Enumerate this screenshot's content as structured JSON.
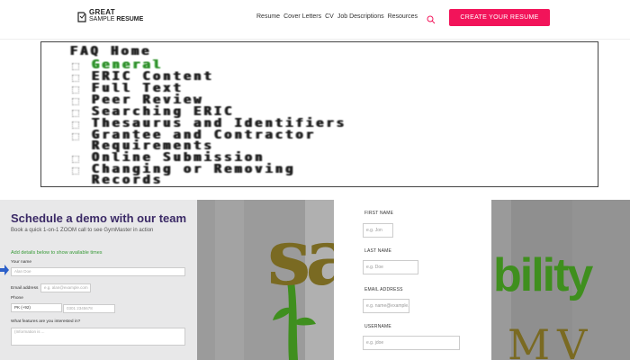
{
  "nav": {
    "logo_line1": "GREAT",
    "logo_line2a": "SAMPLE ",
    "logo_line2b": "RESUME",
    "links": [
      "Resume",
      "Cover Letters",
      "CV",
      "Job Descriptions",
      "Resources"
    ],
    "cta_label": "CREATE YOUR RESUME",
    "accent": "#f2145a"
  },
  "faq": {
    "lines": [
      "FAQ Home",
      "General",
      "ERIC Content",
      "Full Text",
      "Peer Review",
      "Searching ERIC",
      "Thesaurus and Identifiers",
      "Grantee and Contractor",
      "Requirements",
      "Online Submission",
      "Changing or Removing",
      "Records"
    ],
    "highlight_color": "#2f8a2a"
  },
  "demo": {
    "title": "Schedule a demo with our team",
    "subtitle": "Book a quick 1-on-1 ZOOM call to see GymMaster in action",
    "note": "Add details below to show available times",
    "name_label": "Your name",
    "name_placeholder": "Alan Doe",
    "email_label": "Email address",
    "email_placeholder": "e.g. alan@example.com",
    "phone_label": "Phone",
    "phone_country": "PK (+92)",
    "phone_placeholder": "0301 2345678",
    "interest_label": "What features are you interested in?",
    "interest_placeholder": "(Information is ..."
  },
  "signup": {
    "first_name_label": "FIRST NAME",
    "first_name_placeholder": "e.g. Jon",
    "last_name_label": "LAST NAME",
    "last_name_placeholder": "e.g. Doe",
    "email_label": "EMAIL ADDRESS",
    "email_placeholder": "e.g. name@example.com",
    "username_label": "USERNAME",
    "username_placeholder": "e.g. jdoe"
  },
  "collage": {
    "left_text": "sa",
    "right_text": "bility",
    "right_sub": "MV",
    "green": "#3f8f1e",
    "olive": "#7a6a22"
  }
}
